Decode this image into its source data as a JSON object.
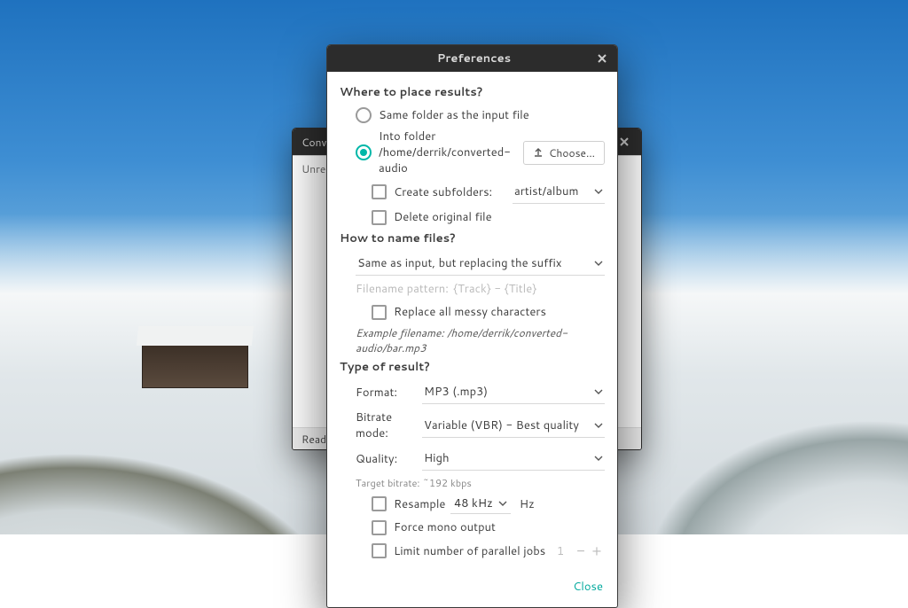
{
  "bg_window": {
    "title": "Conve",
    "content_line": "Unreco",
    "status": "Ready"
  },
  "dialog": {
    "title": "Preferences",
    "sections": {
      "results": {
        "heading": "Where to place results?",
        "same_folder": "Same folder as the input file",
        "into_folder_prefix": "Into folder ",
        "into_folder_path": "/home/derrik/converted-audio",
        "choose_btn": "Choose...",
        "create_subfolders": "Create subfolders:",
        "subfolder_pattern": "artist/album",
        "delete_original": "Delete original file"
      },
      "naming": {
        "heading": "How to name files?",
        "mode": "Same as input, but replacing the suffix",
        "pattern_label": "Filename pattern:",
        "pattern_placeholder": "{Track} - {Title}",
        "replace_messy": "Replace all messy characters",
        "example_prefix": "Example filename: ",
        "example_value": "/home/derrik/converted-audio/bar.mp3"
      },
      "result_type": {
        "heading": "Type of result?",
        "format_label": "Format:",
        "format_value": "MP3 (.mp3)",
        "bitrate_mode_label": "Bitrate mode:",
        "bitrate_mode_value": "Variable (VBR) - Best quality",
        "quality_label": "Quality:",
        "quality_value": "High",
        "target_bitrate": "Target bitrate: ~192 kbps",
        "resample_label": "Resample",
        "resample_value": "48 kHz",
        "resample_unit": "Hz",
        "force_mono": "Force mono output",
        "limit_jobs": "Limit number of parallel jobs",
        "jobs_value": "1"
      }
    },
    "close": "Close"
  }
}
